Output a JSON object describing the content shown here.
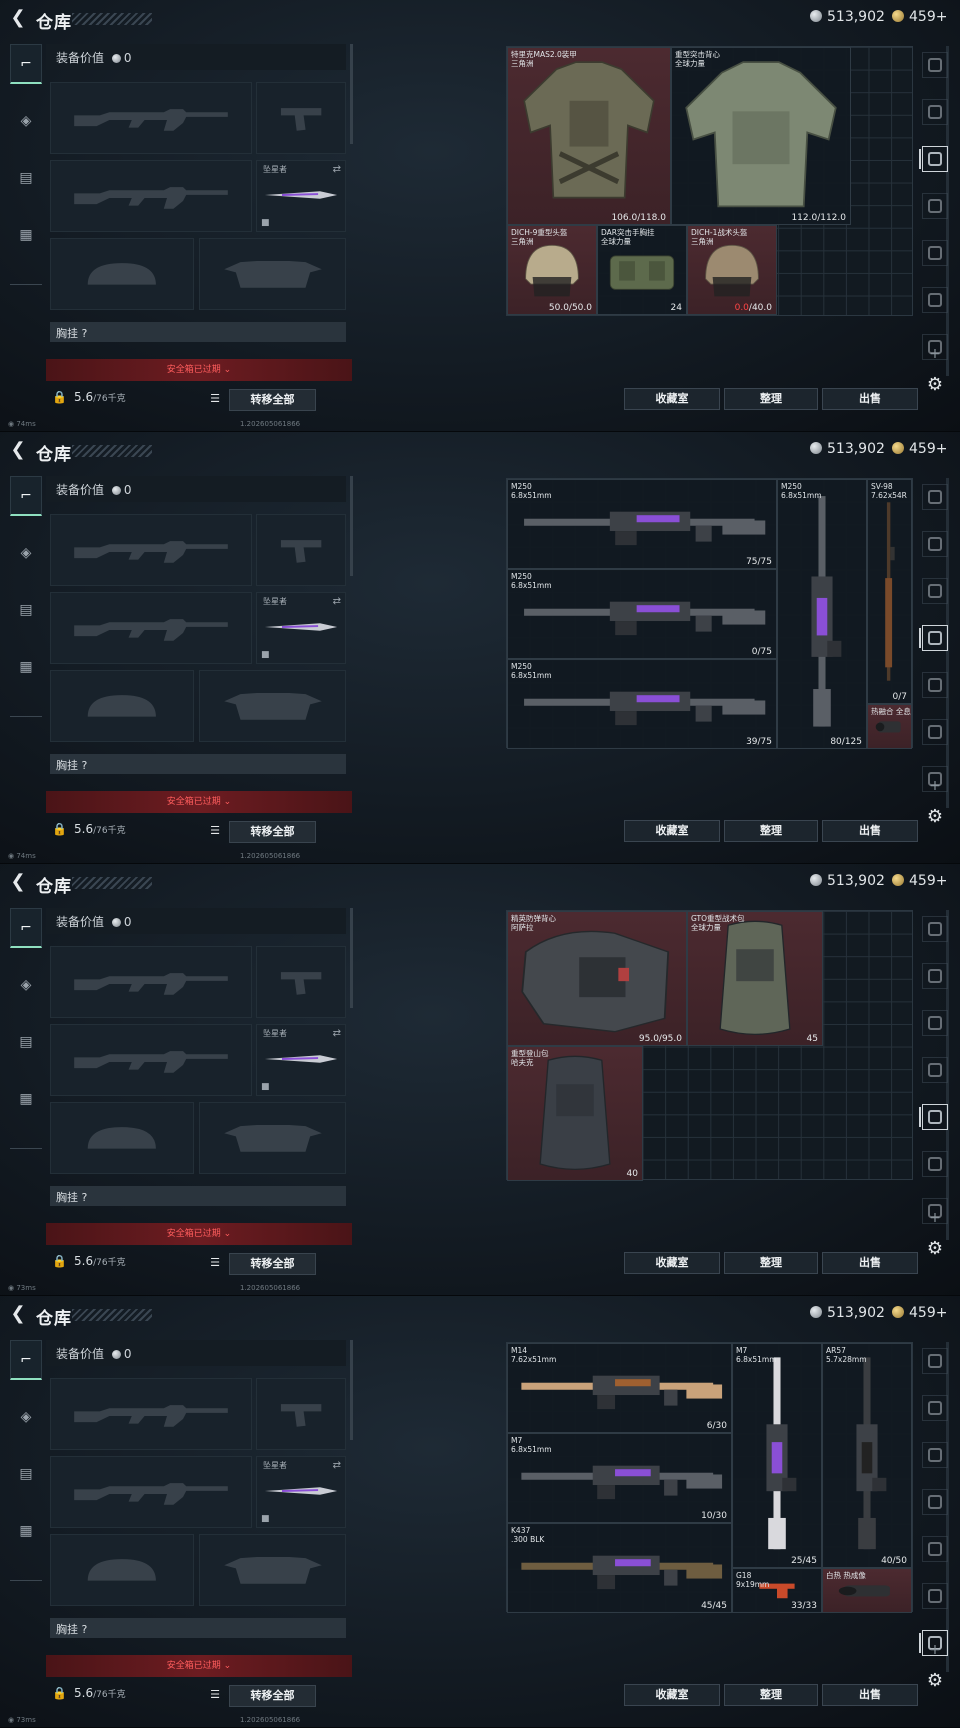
{
  "header": {
    "title": "仓库",
    "silver": "513,902",
    "gold": "459+"
  },
  "equipment": {
    "value_label": "装备价值",
    "value": "0",
    "knife_label": "坠星者",
    "chest_label": "胸挂",
    "chest_hint": "?",
    "safebox_expired": "安全箱已过期",
    "weight": "5.6",
    "weight_max": "/76千克",
    "transfer_all": "转移全部"
  },
  "actions": {
    "favorites": "收藏室",
    "organize": "整理",
    "sell": "出售"
  },
  "panes": [
    {
      "ping": "74ms",
      "build": "1.202605061866",
      "items": [
        {
          "name": "特里克MAS2.0装甲\n三角洲",
          "count": "106.0/118.0"
        },
        {
          "name": "重型突击背心\n全球力量",
          "count": "112.0/112.0"
        },
        {
          "name": "DICH-9重型头盔\n三角洲",
          "count": "50.0/50.0"
        },
        {
          "name": "DAR突击手胸挂\n全球力量",
          "count": "24"
        },
        {
          "name": "DICH-1战术头盔\n三角洲",
          "count_red": "0.0",
          "count": "/40.0"
        }
      ]
    },
    {
      "ping": "74ms",
      "build": "1.202605061866",
      "items": [
        {
          "name": "M250\n6.8x51mm",
          "count": "75/75"
        },
        {
          "name": "M250\n6.8x51mm",
          "count": "0/75"
        },
        {
          "name": "M250\n6.8x51mm",
          "count": "39/75"
        },
        {
          "name": "M250\n6.8x51mm",
          "count": "80/125"
        },
        {
          "name": "SV-98\n7.62x54R",
          "count": "0/7"
        },
        {
          "name": "热融合 全息",
          "count": ""
        }
      ]
    },
    {
      "ping": "73ms",
      "build": "1.202605061866",
      "items": [
        {
          "name": "精英防弹背心\n阿萨拉",
          "count": "95.0/95.0"
        },
        {
          "name": "GTO重型战术包\n全球力量",
          "count": "45"
        },
        {
          "name": "重型登山包\n哈夫克",
          "count": "40"
        }
      ]
    },
    {
      "ping": "73ms",
      "build": "1.202605061866",
      "items": [
        {
          "name": "M14\n7.62x51mm",
          "count": "6/30"
        },
        {
          "name": "M7\n6.8x51mm",
          "count": "10/30"
        },
        {
          "name": "K437\n.300 BLK",
          "count": "45/45"
        },
        {
          "name": "M7\n6.8x51mm",
          "count": "25/45"
        },
        {
          "name": "AR57\n5.7x28mm",
          "count": "40/50"
        },
        {
          "name": "G18\n9x19mm",
          "count": "33/33"
        },
        {
          "name": "白热 热成像",
          "count": ""
        }
      ]
    }
  ],
  "colors": {
    "accent": "#8fe0c0",
    "alert_red": "#ff4545",
    "item_red_bg": "#4c2a30"
  }
}
